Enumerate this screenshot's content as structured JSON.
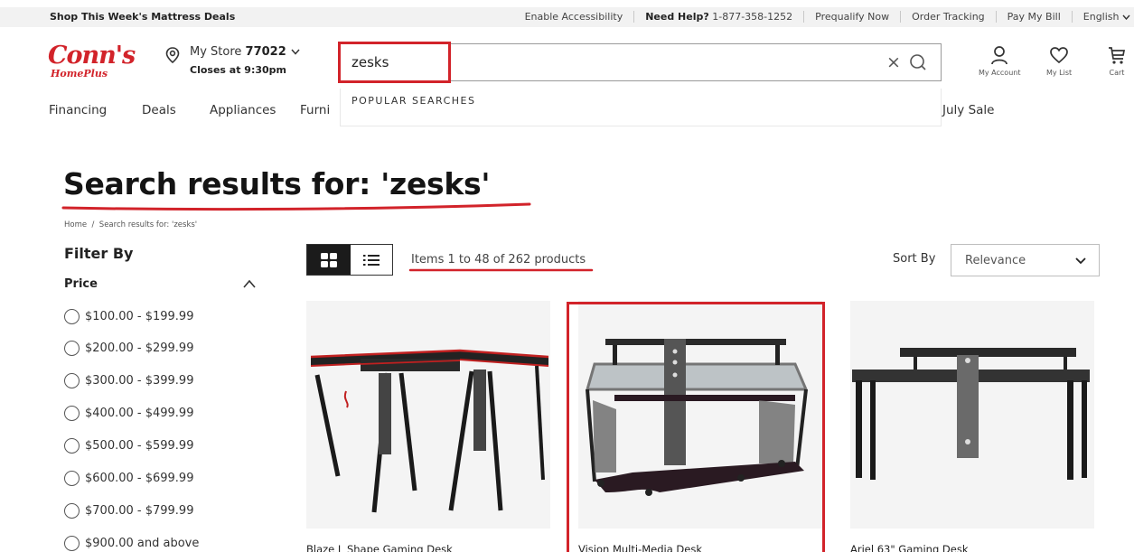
{
  "topbar": {
    "promo": "Shop This Week's Mattress Deals",
    "accessibility": "Enable Accessibility",
    "help_label": "Need Help?",
    "help_phone": "1-877-358-1252",
    "prequalify": "Prequalify Now",
    "order_tracking": "Order Tracking",
    "pay_bill": "Pay My Bill",
    "language": "English"
  },
  "header": {
    "logo_main": "Conn's",
    "logo_sub": "HomePlus",
    "store_label": "My Store",
    "store_number": "77022",
    "store_hours": "Closes at 9:30pm",
    "search_value": "zesks",
    "clear_icon": "×",
    "account_label": "My Account",
    "list_label": "My List",
    "cart_label": "Cart"
  },
  "search_dropdown": {
    "heading": "POPULAR SEARCHES"
  },
  "nav": {
    "items": [
      "Financing",
      "Deals",
      "Appliances",
      "Furni",
      "July Sale"
    ]
  },
  "page": {
    "title": "Search results for: 'zesks'",
    "breadcrumb_home": "Home",
    "breadcrumb_sep": "/",
    "breadcrumb_current": "Search results for: 'zesks'"
  },
  "filters": {
    "heading": "Filter By",
    "price_heading": "Price",
    "price_options": [
      "$100.00 - $199.99",
      "$200.00 - $299.99",
      "$300.00 - $399.99",
      "$400.00 - $499.99",
      "$500.00 - $599.99",
      "$600.00 - $699.99",
      "$700.00 - $799.99",
      "$900.00 and above"
    ]
  },
  "results": {
    "count_text": "Items 1 to 48 of 262 products",
    "sort_label": "Sort By",
    "sort_value": "Relevance",
    "view_mode": "grid"
  },
  "products": [
    {
      "name": "Blaze L Shape Gaming Desk"
    },
    {
      "name": "Vision Multi-Media Desk"
    },
    {
      "name": "Ariel 63\" Gaming Desk"
    }
  ],
  "colors": {
    "brand_red": "#d2232a",
    "annotation_red": "#d2232a",
    "dark": "#1b1b1b"
  },
  "icons": {
    "store": "location-pin-icon",
    "search": "search-icon",
    "clear": "close-icon",
    "account": "user-icon",
    "list": "heart-icon",
    "cart": "cart-icon",
    "grid": "grid-view-icon",
    "list_view": "list-view-icon",
    "sort": "chevron-down-icon",
    "price_toggle": "chevron-up-icon"
  }
}
